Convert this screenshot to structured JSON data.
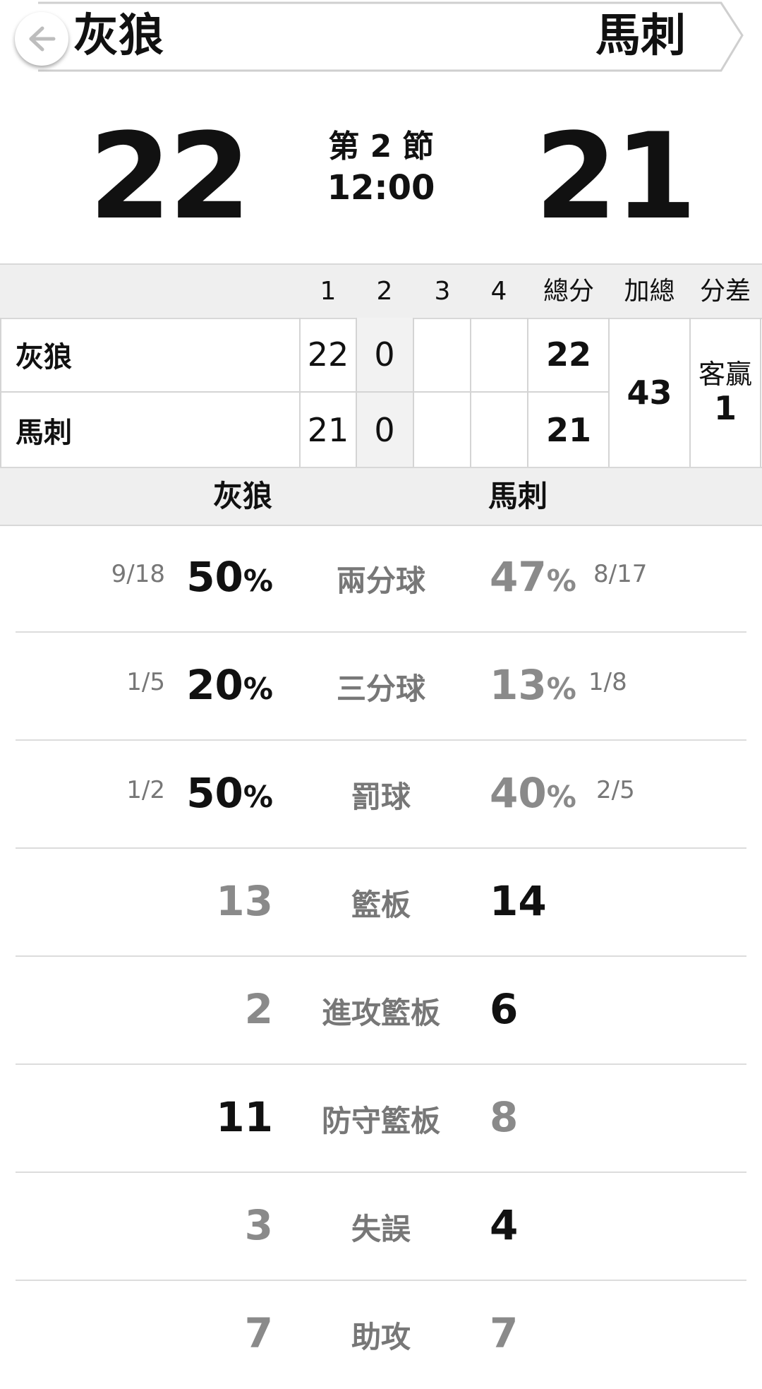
{
  "header": {
    "home_team": "灰狼",
    "away_team": "馬刺",
    "back_icon": "arrow-left-icon"
  },
  "scoreboard": {
    "home_score": "22",
    "away_score": "21",
    "period": "第 2 節",
    "clock": "12:00"
  },
  "quarter_table": {
    "headers": [
      "1",
      "2",
      "3",
      "4",
      "總分",
      "加總",
      "分差"
    ],
    "rows": [
      {
        "team": "灰狼",
        "q1": "22",
        "q2": "0",
        "q3": "",
        "q4": "",
        "total": "22"
      },
      {
        "team": "馬刺",
        "q1": "21",
        "q2": "0",
        "q3": "",
        "q4": "",
        "total": "21"
      }
    ],
    "combined": "43",
    "diff_label": "客贏",
    "diff_value": "1",
    "team_bar": [
      "灰狼",
      "馬刺"
    ]
  },
  "stats": [
    {
      "label": "兩分球",
      "home_frac": "9/18",
      "home_value": "50",
      "home_unit": "%",
      "away_value": "47",
      "away_unit": "%",
      "away_frac": "8/17",
      "leader": "home"
    },
    {
      "label": "三分球",
      "home_frac": "1/5",
      "home_value": "20",
      "home_unit": "%",
      "away_value": "13",
      "away_unit": "%",
      "away_frac": "1/8",
      "leader": "home"
    },
    {
      "label": "罰球",
      "home_frac": "1/2",
      "home_value": "50",
      "home_unit": "%",
      "away_value": "40",
      "away_unit": "%",
      "away_frac": "2/5",
      "leader": "home"
    },
    {
      "label": "籃板",
      "home_value": "13",
      "away_value": "14",
      "leader": "away"
    },
    {
      "label": "進攻籃板",
      "home_value": "2",
      "away_value": "6",
      "leader": "away"
    },
    {
      "label": "防守籃板",
      "home_value": "11",
      "away_value": "8",
      "leader": "home"
    },
    {
      "label": "失誤",
      "home_value": "3",
      "away_value": "4",
      "leader": "away"
    },
    {
      "label": "助攻",
      "home_value": "7",
      "away_value": "7",
      "leader": "none"
    }
  ],
  "colors": {
    "leader": "#111111",
    "trailer": "#8a8a8a",
    "table_bg": "#efefef",
    "grid": "#d4d4d4"
  }
}
